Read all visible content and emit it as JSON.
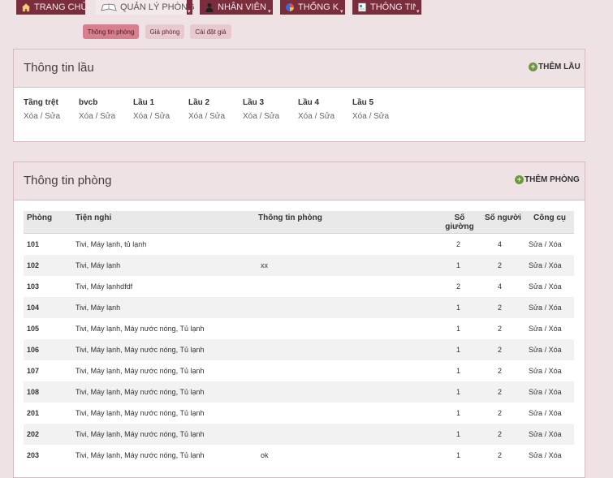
{
  "nav": [
    {
      "label": "TRANG CHỦ",
      "icon": "home-icon"
    },
    {
      "label": "QUẢN LÝ PHÒNG",
      "icon": "book-icon",
      "active": true
    },
    {
      "label": "NHÂN VIÊN",
      "icon": "user-icon"
    },
    {
      "label": "THỐNG KÊ",
      "icon": "pie-chart-icon"
    },
    {
      "label": "THÔNG TIN",
      "icon": "info-doc-icon"
    }
  ],
  "subtabs": [
    {
      "label": "Thông tin phòng",
      "active": true
    },
    {
      "label": "Giá phòng"
    },
    {
      "label": "Cài đặt giá"
    }
  ],
  "floor_panel": {
    "title": "Thông tin lầu",
    "add_label": "THÊM LẦU",
    "delete_label": "Xóa",
    "separator": "/",
    "edit_label": "Sửa",
    "floors": [
      "Tầng trệt",
      "bvcb",
      "Lầu 1",
      "Lầu 2",
      "Lầu 3",
      "Lầu 4",
      "Lầu 5"
    ]
  },
  "room_panel": {
    "title": "Thông tin phòng",
    "add_label": "THÊM PHÒNG",
    "columns": {
      "room": "Phòng",
      "amenities": "Tiện nghi",
      "info": "Thông tin phòng",
      "beds": "Số giường",
      "people": "Số người",
      "tools": "Công cụ"
    },
    "edit_label": "Sửa",
    "separator": "/",
    "delete_label": "Xóa",
    "rows": [
      {
        "room": "101",
        "amenities": "Tivi, Máy lạnh, tủ lạnh",
        "info": "",
        "beds": "2",
        "people": "4"
      },
      {
        "room": "102",
        "amenities": "Tivi, Máy lạnh",
        "info": "xx",
        "beds": "1",
        "people": "2"
      },
      {
        "room": "103",
        "amenities": "Tivi, Máy lạnhdfdf",
        "info": "",
        "beds": "2",
        "people": "4"
      },
      {
        "room": "104",
        "amenities": "Tivi, Máy lạnh",
        "info": "",
        "beds": "1",
        "people": "2"
      },
      {
        "room": "105",
        "amenities": "Tivi, Máy lạnh, Máy nước nóng, Tủ lạnh",
        "info": "",
        "beds": "1",
        "people": "2"
      },
      {
        "room": "106",
        "amenities": "Tivi, Máy lạnh, Máy nước nóng, Tủ lạnh",
        "info": "",
        "beds": "1",
        "people": "2"
      },
      {
        "room": "107",
        "amenities": "Tivi, Máy lạnh, Máy nước nóng, Tủ lạnh",
        "info": "",
        "beds": "1",
        "people": "2"
      },
      {
        "room": "108",
        "amenities": "Tivi, Máy lạnh, Máy nước nóng, Tủ lạnh",
        "info": "",
        "beds": "1",
        "people": "2"
      },
      {
        "room": "201",
        "amenities": "Tivi, Máy lạnh, Máy nước nóng, Tủ lạnh",
        "info": "",
        "beds": "1",
        "people": "2"
      },
      {
        "room": "202",
        "amenities": "Tivi, Máy lạnh, Máy nước nóng, Tủ lạnh",
        "info": "",
        "beds": "1",
        "people": "2"
      },
      {
        "room": "203",
        "amenities": "Tivi, Máy lạnh, Máy nước nóng, Tủ lạnh",
        "info": "ok",
        "beds": "1",
        "people": "2"
      }
    ]
  }
}
